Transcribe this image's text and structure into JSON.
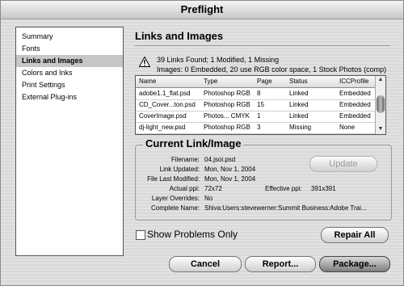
{
  "window": {
    "title": "Preflight"
  },
  "sidebar": {
    "items": [
      {
        "label": "Summary",
        "selected": false
      },
      {
        "label": "Fonts",
        "selected": false
      },
      {
        "label": "Links and Images",
        "selected": true
      },
      {
        "label": "Colors and Inks",
        "selected": false
      },
      {
        "label": "Print Settings",
        "selected": false
      },
      {
        "label": "External Plug-ins",
        "selected": false
      }
    ]
  },
  "panel": {
    "title": "Links and Images",
    "summary_line1": "39 Links Found; 1 Modified, 1 Missing",
    "summary_line2": "Images: 0 Embedded, 20 use RGB color space, 1 Stock Photos (comp)"
  },
  "table": {
    "headers": [
      "Name",
      "Type",
      "Page",
      "Status",
      "ICCProfile"
    ],
    "rows": [
      [
        "adobe1.1_flat.psd",
        "Photoshop RGB",
        "8",
        "Linked",
        "Embedded"
      ],
      [
        "CD_Cover...ton.psd",
        "Photoshop RGB",
        "15",
        "Linked",
        "Embedded"
      ],
      [
        "CoverImage.psd",
        "Photos... CMYK",
        "1",
        "Linked",
        "Embedded"
      ],
      [
        "dj-light_new.psd",
        "Photoshop RGB",
        "3",
        "Missing",
        "None"
      ]
    ]
  },
  "current_link": {
    "title": "Current Link/Image",
    "filename_label": "Filename:",
    "filename": "04.jsoi.psd",
    "updated_label": "Link Updated:",
    "updated": "Mon, Nov 1, 2004",
    "modified_label": "File Last Modified:",
    "modified": "Mon, Nov 1, 2004",
    "actual_ppi_label": "Actual ppi:",
    "actual_ppi": "72x72",
    "effective_ppi_label": "Effective ppi:",
    "effective_ppi": "391x391",
    "overrides_label": "Layer Overrides:",
    "overrides": "No",
    "complete_name_label": "Complete Name:",
    "complete_name": "Shiva:Users:stevewerner:Summit Business:Adobe Trai...",
    "update_label": "Update"
  },
  "options": {
    "show_problems_label": "Show Problems Only",
    "show_problems_checked": false
  },
  "buttons": {
    "repair": "Repair All",
    "cancel": "Cancel",
    "report": "Report...",
    "package": "Package..."
  }
}
